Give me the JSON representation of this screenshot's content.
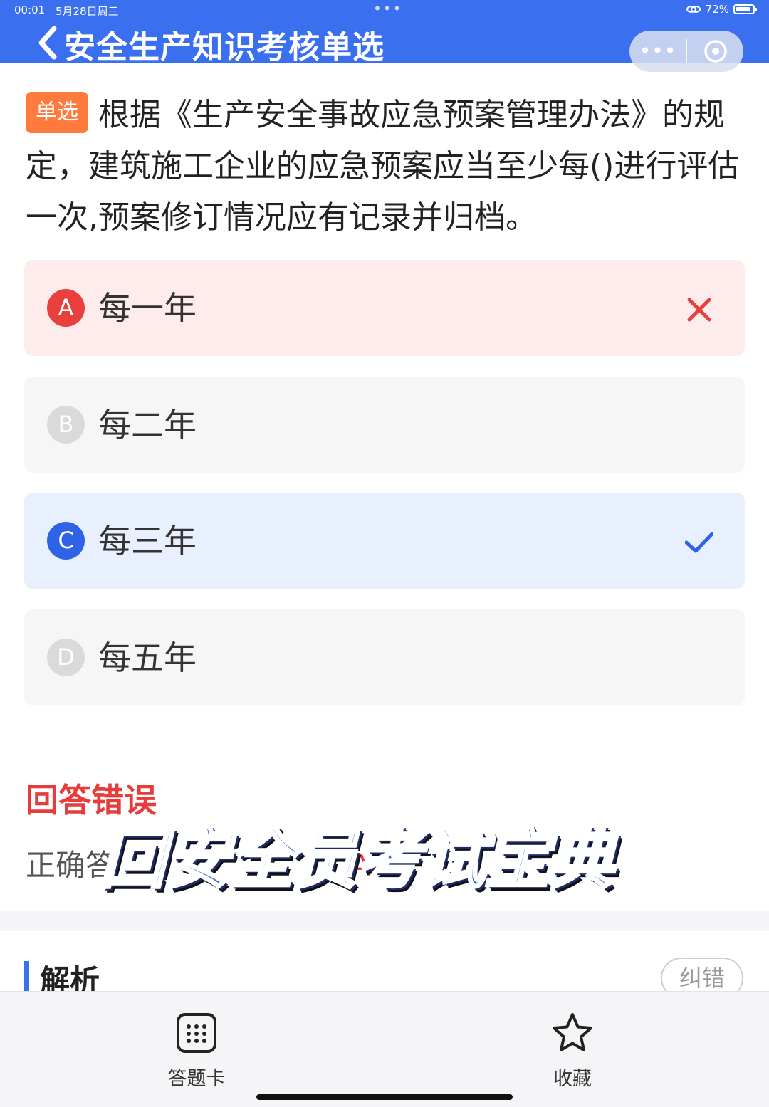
{
  "status_bar": {
    "time": "00:01",
    "date": "5月28日周三",
    "dots": "•••",
    "battery": "72%"
  },
  "header": {
    "title": "安全生产知识考核单选",
    "capsule_more": "•••",
    "background": "#3a6ff0"
  },
  "question": {
    "type_badge": "单选",
    "text": "根据《生产安全事故应急预案管理办法》的规定，建筑施工企业的应急预案应当至少每()进行评估一次,预案修订情况应有记录并归档。"
  },
  "options": [
    {
      "letter": "A",
      "text": "每一年",
      "state": "wrong"
    },
    {
      "letter": "B",
      "text": "每二年",
      "state": "normal"
    },
    {
      "letter": "C",
      "text": "每三年",
      "state": "correct"
    },
    {
      "letter": "D",
      "text": "每五年",
      "state": "normal"
    }
  ],
  "result": {
    "title": "回答错误",
    "correct_label": "正确答",
    "your_label": "A"
  },
  "watermark": "回安全员考试宝典",
  "analysis": {
    "title": "解析",
    "report_button": "纠错"
  },
  "tabbar": {
    "answer_card": "答题卡",
    "favorite": "收藏"
  },
  "colors": {
    "accent": "#3a6ff0",
    "wrong": "#e9403d",
    "right": "#2e63e8",
    "badge": "#ff7a3d"
  }
}
